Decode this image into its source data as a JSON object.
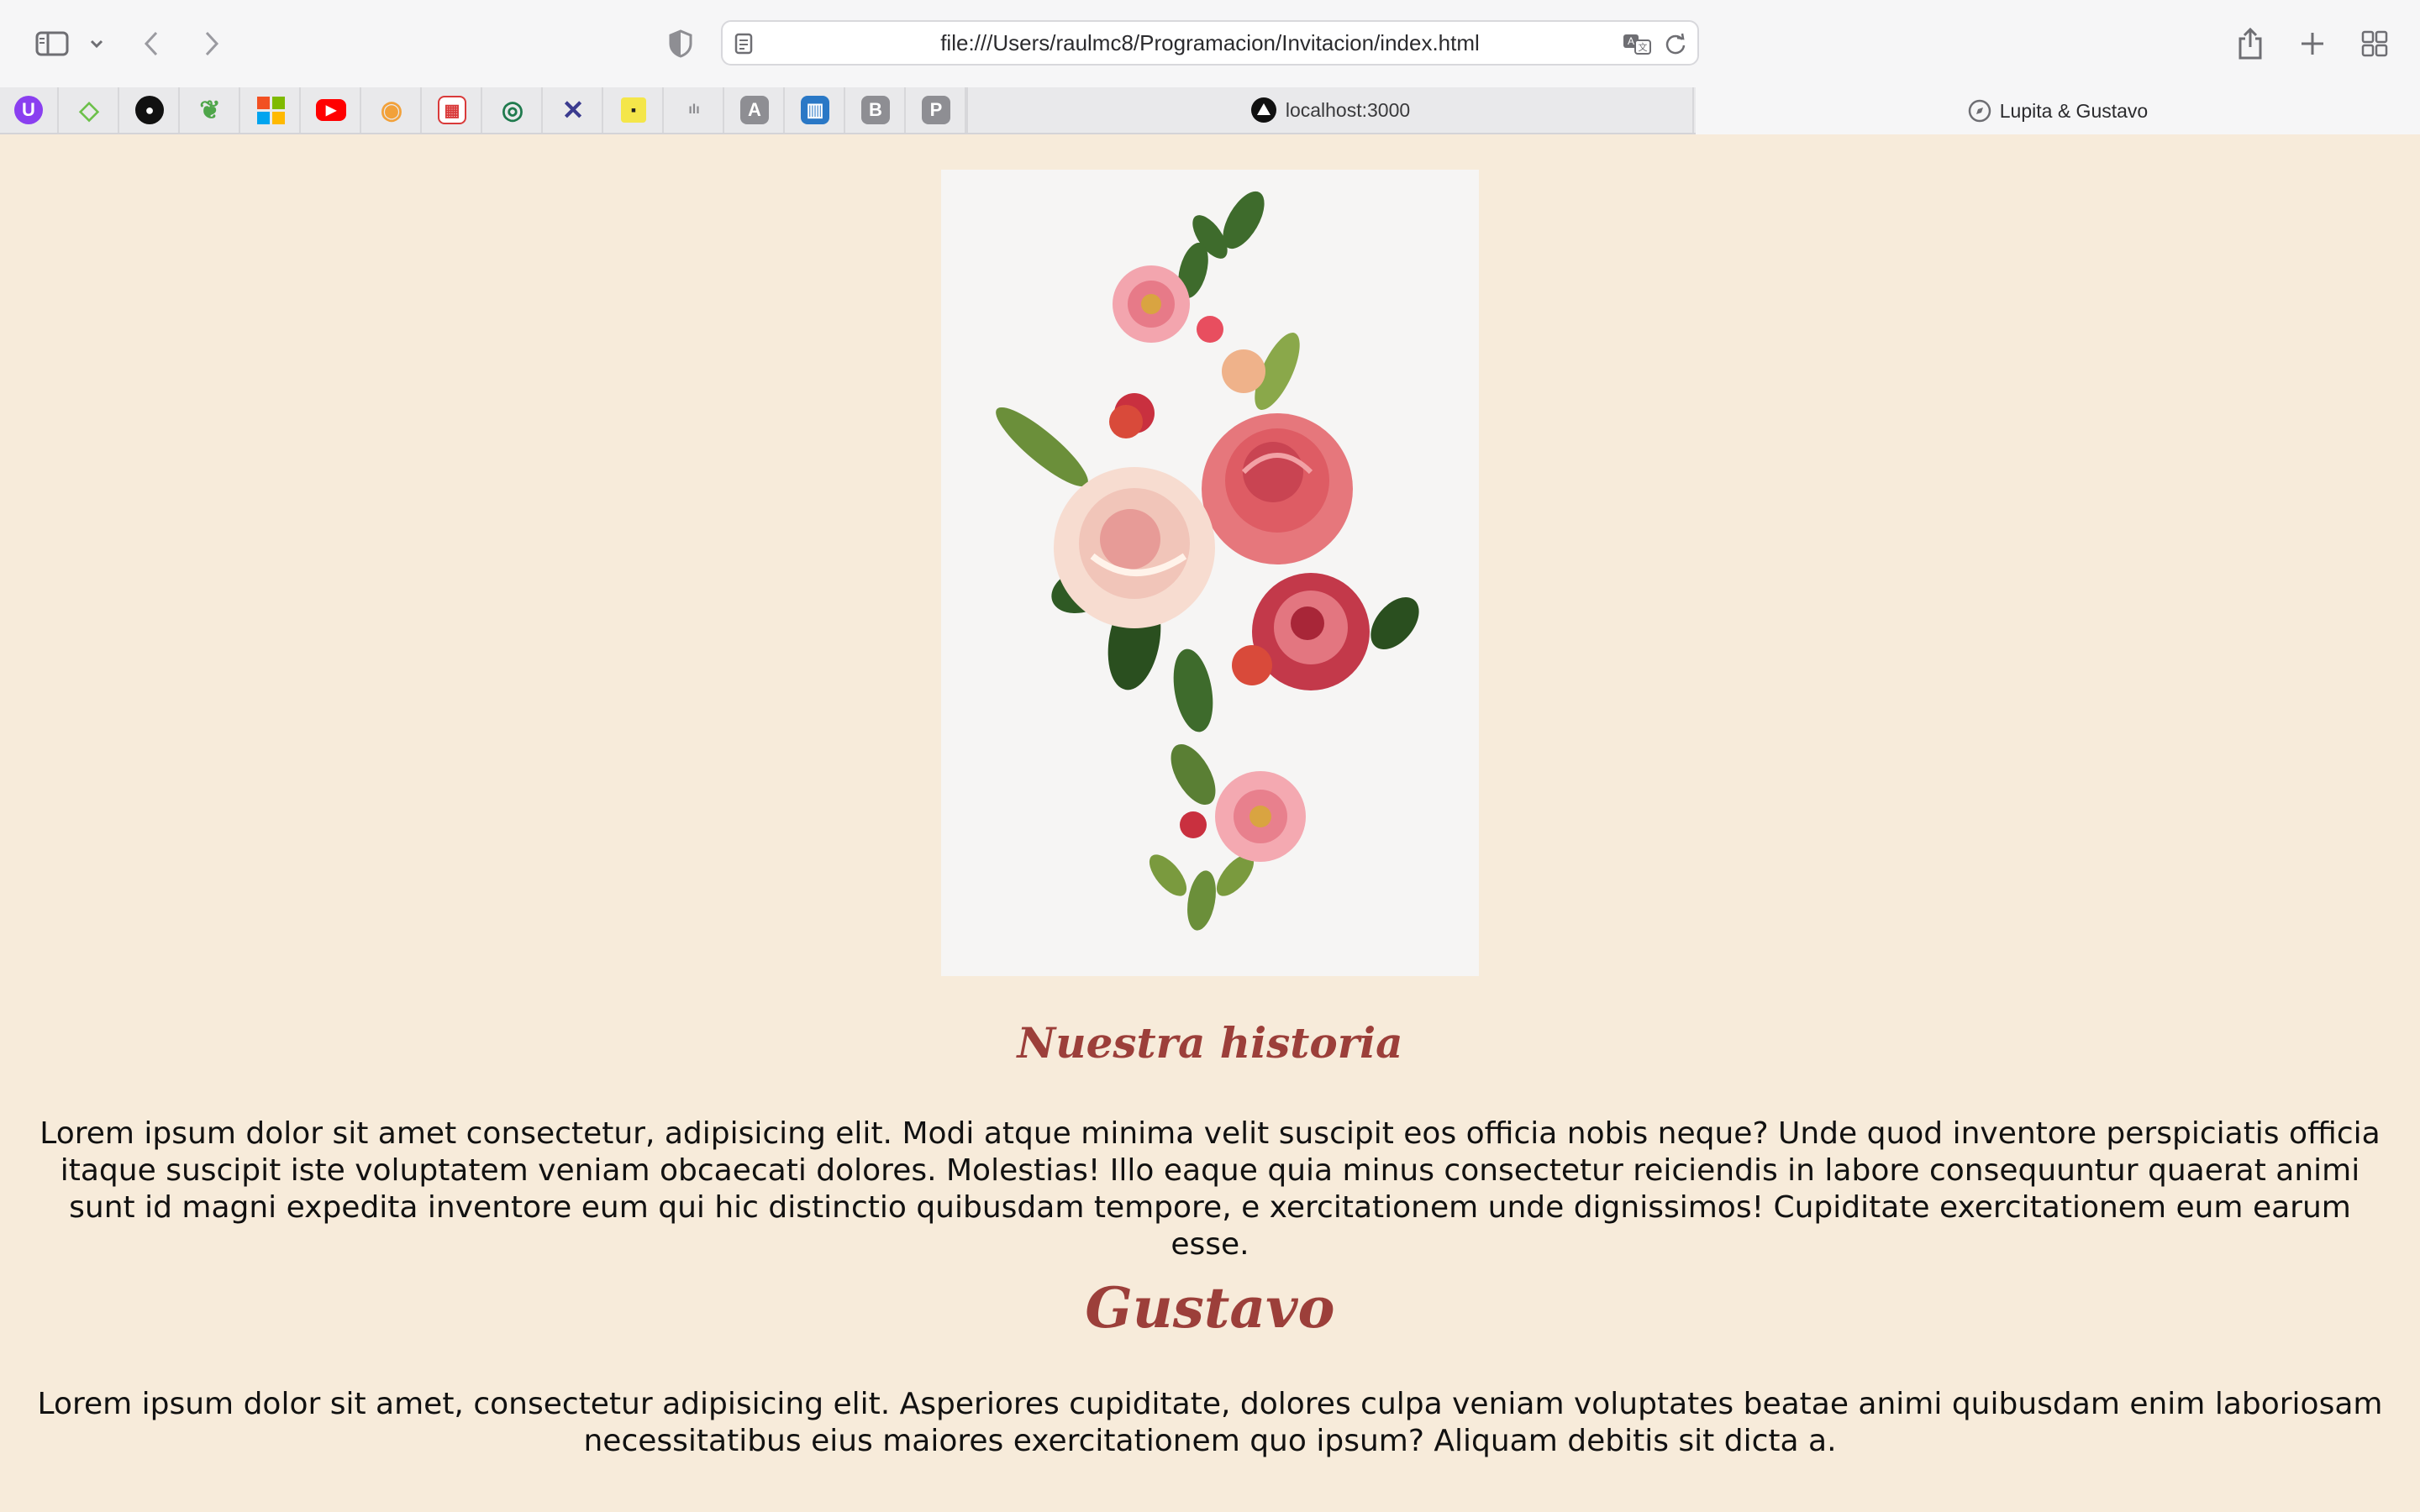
{
  "browser": {
    "address": "file:///Users/raulmc8/Programacion/Invitacion/index.html",
    "favorites": [
      {
        "name": "u-favicon",
        "glyph": "U",
        "color": "#8a3ff0"
      },
      {
        "name": "green-diamond-favicon",
        "glyph": "◇",
        "color": "#6cc04a"
      },
      {
        "name": "github-favicon",
        "glyph": "●",
        "color": "#111111"
      },
      {
        "name": "leaf-favicon",
        "glyph": "❦",
        "color": "#4fa64a"
      },
      {
        "name": "microsoft-favicon",
        "glyph": "■",
        "color": "#f25022"
      },
      {
        "name": "youtube-favicon",
        "glyph": "▶",
        "color": "#ff0000"
      },
      {
        "name": "pin-favicon",
        "glyph": "◉",
        "color": "#f2a13a"
      },
      {
        "name": "calendar-favicon",
        "glyph": "▦",
        "color": "#d93a3a"
      },
      {
        "name": "eye-favicon",
        "glyph": "◎",
        "color": "#1f7a4d"
      },
      {
        "name": "x-favicon",
        "glyph": "✕",
        "color": "#3b3b8f"
      },
      {
        "name": "yellow-favicon",
        "glyph": "▪",
        "color": "#f4e64a"
      },
      {
        "name": "cisco-favicon",
        "glyph": "ılı",
        "color": "#8a8a8e"
      },
      {
        "name": "a-favicon",
        "glyph": "A",
        "color": "#8e8e93"
      },
      {
        "name": "trello-favicon",
        "glyph": "▥",
        "color": "#2a78c6"
      },
      {
        "name": "b-favicon",
        "glyph": "B",
        "color": "#8e8e93"
      },
      {
        "name": "p-favicon",
        "glyph": "P",
        "color": "#8e8e93"
      }
    ],
    "tabs": [
      {
        "label": "localhost:3000"
      },
      {
        "label": "Lupita & Gustavo"
      }
    ]
  },
  "page": {
    "story_heading": "Nuestra historia",
    "story_text": "Lorem ipsum dolor sit amet consectetur, adipisicing elit. Modi atque minima velit suscipit eos officia nobis neque? Unde quod inventore perspiciatis officia itaque suscipit iste voluptatem veniam obcaecati dolores. Molestias! Illo eaque quia minus consectetur reiciendis in labore consequuntur quaerat animi sunt id magni expedita inventore eum qui hic distinctio quibusdam tempore, e xercitationem unde dignissimos! Cupiditate exercitationem eum earum esse.",
    "groom_heading": "Gustavo",
    "groom_text": "Lorem ipsum dolor sit amet, consectetur adipisicing elit. Asperiores cupiditate, dolores culpa veniam voluptates beatae animi quibusdam enim laboriosam necessitatibus eius maiores exercitationem quo ipsum? Aliquam debitis sit dicta a."
  },
  "colors": {
    "page_bg": "#f7ebda",
    "heading": "#9c3f3a"
  }
}
